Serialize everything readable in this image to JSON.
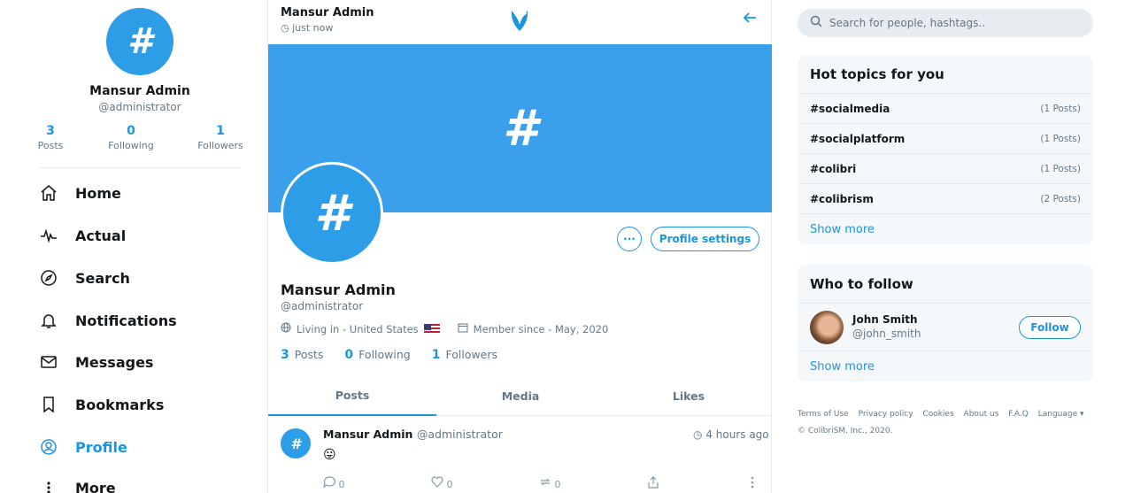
{
  "user": {
    "avatar_glyph": "#",
    "name": "Mansur Admin",
    "handle": "@administrator",
    "posts_count": "3",
    "posts_label": "Posts",
    "following_count": "0",
    "following_label": "Following",
    "followers_count": "1",
    "followers_label": "Followers"
  },
  "nav": {
    "items": [
      {
        "label": "Home",
        "icon": "home-icon"
      },
      {
        "label": "Actual",
        "icon": "pulse-icon"
      },
      {
        "label": "Search",
        "icon": "compass-icon"
      },
      {
        "label": "Notifications",
        "icon": "bell-icon"
      },
      {
        "label": "Messages",
        "icon": "envelope-icon"
      },
      {
        "label": "Bookmarks",
        "icon": "bookmark-icon"
      },
      {
        "label": "Profile",
        "icon": "user-circle-icon"
      },
      {
        "label": "More",
        "icon": "more-vertical-icon"
      }
    ],
    "active": "Profile"
  },
  "header": {
    "name": "Mansur Admin",
    "time": "just now",
    "logo_icon": "bird-logo-icon",
    "back_icon": "arrow-left-icon"
  },
  "profile": {
    "cover_glyph": "#",
    "avatar_glyph": "#",
    "dots_label": "···",
    "settings_label": "Profile settings",
    "name": "Mansur Admin",
    "handle": "@administrator",
    "living_in": "Living in - United States",
    "member_since": "Member since - May, 2020",
    "posts_count": "3",
    "posts_label": "Posts",
    "following_count": "0",
    "following_label": "Following",
    "followers_count": "1",
    "followers_label": "Followers"
  },
  "tabs": [
    {
      "label": "Posts"
    },
    {
      "label": "Media"
    },
    {
      "label": "Likes"
    }
  ],
  "post": {
    "avatar_glyph": "#",
    "author": "Mansur Admin",
    "handle": "@administrator",
    "time": "4 hours ago",
    "emoji": "😛",
    "replies": "0",
    "likes": "0",
    "reposts": "0"
  },
  "search": {
    "placeholder": "Search for people, hashtags.."
  },
  "topics": {
    "title": "Hot topics for you",
    "items": [
      {
        "tag": "#socialmedia",
        "count": "(1 Posts)"
      },
      {
        "tag": "#socialplatform",
        "count": "(1 Posts)"
      },
      {
        "tag": "#colibri",
        "count": "(1 Posts)"
      },
      {
        "tag": "#colibrism",
        "count": "(2 Posts)"
      }
    ],
    "show_more": "Show more"
  },
  "who_to_follow": {
    "title": "Who to follow",
    "user_name": "John Smith",
    "user_handle": "@john_smith",
    "follow_label": "Follow",
    "show_more": "Show more"
  },
  "footer": {
    "links": [
      "Terms of Use",
      "Privacy policy",
      "Cookies",
      "About us",
      "F.A.Q",
      "Language ▾"
    ],
    "copyright": "© ColibriSM, Inc., 2020."
  },
  "colors": {
    "accent": "#1b95e0",
    "cover": "#3aa0ec"
  }
}
